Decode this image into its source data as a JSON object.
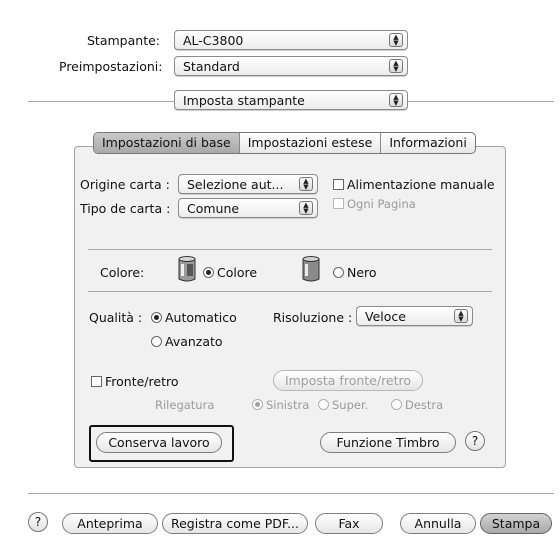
{
  "printer_row": {
    "label": "Stampante:",
    "value": "AL-C3800"
  },
  "presets_row": {
    "label": "Preimpostazioni:",
    "value": "Standard"
  },
  "section_popup": {
    "value": "Imposta stampante"
  },
  "tabs": [
    {
      "label": "Impostazioni di base",
      "selected": true
    },
    {
      "label": "Impostazioni estese",
      "selected": false
    },
    {
      "label": "Informazioni",
      "selected": false
    }
  ],
  "paper": {
    "source_label": "Origine carta :",
    "source_value": "Selezione aut...",
    "type_label": "Tipo de carta :",
    "type_value": "Comune",
    "manual_feed_label": "Alimentazione manuale",
    "every_page_label": "Ogni Pagina"
  },
  "color": {
    "label": "Colore:",
    "opt_color": "Colore",
    "opt_black": "Nero"
  },
  "quality": {
    "label": "Qualità :",
    "opt_auto": "Automatico",
    "opt_advanced": "Avanzato",
    "resolution_label": "Risoluzione :",
    "resolution_value": "Veloce"
  },
  "duplex": {
    "checkbox_label": "Fronte/retro",
    "setup_button": "Imposta fronte/retro",
    "binding_label": "Rilegatura",
    "opt_left": "Sinistra",
    "opt_top": "Super.",
    "opt_right": "Destra"
  },
  "panel_buttons": {
    "save_job": "Conserva lavoro",
    "watermark": "Funzione Timbro",
    "help": "?"
  },
  "bottom_bar": {
    "help": "?",
    "preview": "Anteprima",
    "save_pdf": "Registra come PDF...",
    "fax": "Fax",
    "cancel": "Annulla",
    "print": "Stampa"
  },
  "colors": {
    "panel_bg": "#f1f1f1",
    "border": "#a4a4a4",
    "selected_tab": "#b8b8b8",
    "disabled_text": "#9a9a9a"
  }
}
